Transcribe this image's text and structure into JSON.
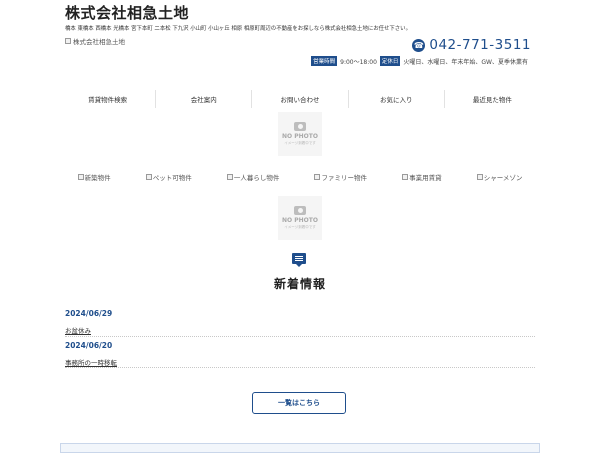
{
  "header": {
    "site_title": "株式会社相急土地",
    "tagline": "橋本 東橋本 西橋本 光橋本 宮下本町 二本松 下九沢 小山町 小山ヶ丘 相原 相原町周辺の不動産をお探しなら株式会社相急土地にお任せ下さい。",
    "logo_alt": "株式会社相急土地",
    "phone": "042-771-3511",
    "hours_label": "営業時間",
    "hours_value": "9:00～18:00",
    "holiday_label": "定休日",
    "holiday_value": "火曜日、水曜日、年末年始、GW、夏季休業有"
  },
  "nav": {
    "items": [
      "賃貸物件検索",
      "会社案内",
      "お問い合わせ",
      "お気に入り",
      "最近見た物件"
    ]
  },
  "placeholder": {
    "title": "NO PHOTO",
    "subtitle": "イメージ到着中です"
  },
  "categories": {
    "items": [
      "新築物件",
      "ペット可物件",
      "一人暮らし物件",
      "ファミリー物件",
      "事業用賃貸",
      "シャーメゾン"
    ]
  },
  "news": {
    "title": "新着情報",
    "items": [
      {
        "date": "2024/06/29",
        "title": "お盆休み"
      },
      {
        "date": "2024/06/20",
        "title": "事務所の一時移転"
      }
    ],
    "more_label": "一覧はこちら"
  },
  "colors": {
    "accent": "#1f4e8c"
  }
}
